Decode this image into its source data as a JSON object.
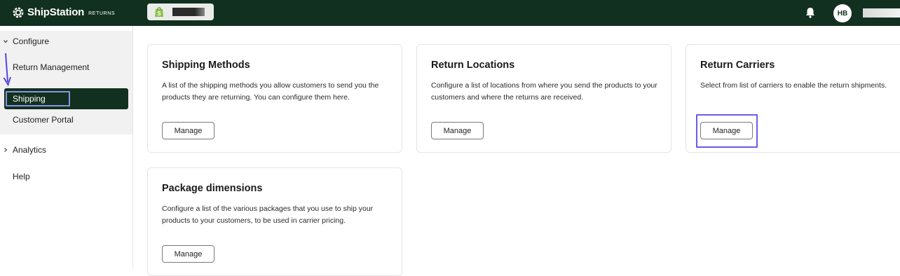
{
  "header": {
    "brand": "ShipStation",
    "brand_sub": "RETURNS",
    "avatar_initials": "HB",
    "colors": {
      "bar": "#12301f",
      "highlight": "#6b5ce7"
    }
  },
  "sidebar": {
    "configure_label": "Configure",
    "items": [
      {
        "label": "Return Management"
      },
      {
        "label": "Shipping"
      },
      {
        "label": "Customer Portal"
      }
    ],
    "analytics_label": "Analytics",
    "help_label": "Help"
  },
  "cards": {
    "shipping_methods": {
      "title": "Shipping Methods",
      "desc": "A list of the shipping methods you allow customers to send you the products they are returning. You can configure them here.",
      "button": "Manage"
    },
    "return_locations": {
      "title": "Return Locations",
      "desc": "Configure a list of locations from where you send the products to your customers and where the returns are received.",
      "button": "Manage"
    },
    "return_carriers": {
      "title": "Return Carriers",
      "desc": "Select from list of carriers to enable the return shipments.",
      "button": "Manage"
    },
    "package_dimensions": {
      "title": "Package dimensions",
      "desc": "Configure a list of the various packages that you use to ship your products to your customers, to be used in carrier pricing.",
      "button": "Manage"
    }
  }
}
